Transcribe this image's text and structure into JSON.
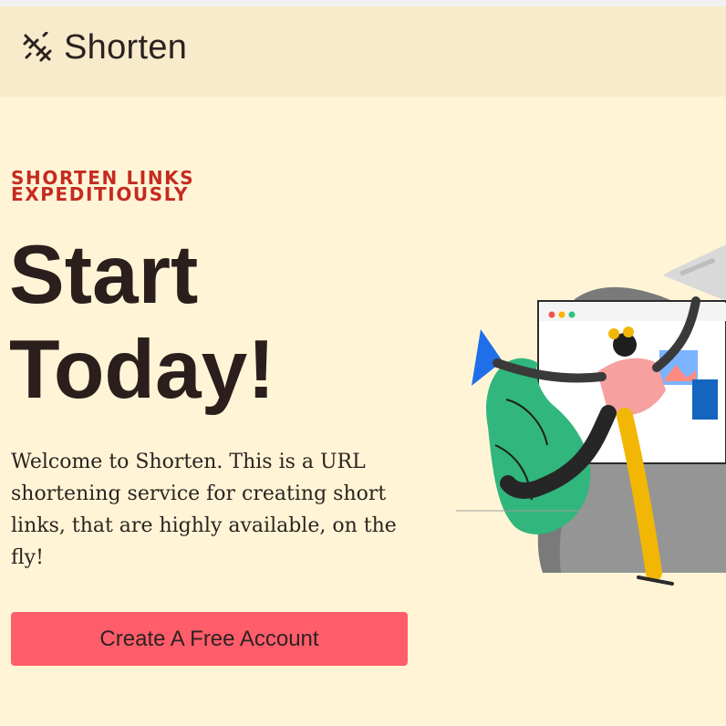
{
  "navbar": {
    "brand_name": "Shorten",
    "brand_icon": "scissors-spark-icon"
  },
  "hero": {
    "eyebrow_line1": "SHORTEN LINKS",
    "eyebrow_line2": "EXPEDITIOUSLY",
    "headline_line1": "Start",
    "headline_line2": "Today!",
    "description": "Welcome to Shorten. This is a URL shortening service for creating short links, that are highly available, on the fly!",
    "cta_label": "Create A Free Account"
  },
  "colors": {
    "page_background": "#fff5d6",
    "navbar_background": "#f7ebcb",
    "accent_red": "#c62a20",
    "cta_background": "#ff5d6a",
    "text_dark": "#2b1f1d"
  }
}
